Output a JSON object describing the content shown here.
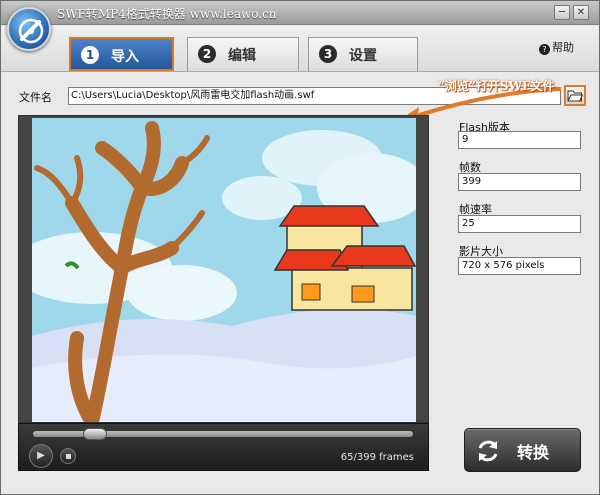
{
  "window": {
    "title": "SWF转MP4格式转换器 www.leawo.cn",
    "minimize_glyph": "─",
    "close_glyph": "✕"
  },
  "tabs": [
    {
      "number": "1",
      "label": "导入",
      "active": true
    },
    {
      "number": "2",
      "label": "编辑",
      "active": false
    },
    {
      "number": "3",
      "label": "设置",
      "active": false
    }
  ],
  "help": {
    "icon_glyph": "?",
    "label": "帮助"
  },
  "file": {
    "label": "文件名",
    "path": "C:\\Users\\Lucia\\Desktop\\风雨雷电交加flash动画.swf",
    "browse_icon": "folder-open-icon"
  },
  "annotation": {
    "text": "“浏览”打开SWF文件"
  },
  "properties": [
    {
      "label": "Flash版本",
      "value": "9"
    },
    {
      "label": "帧数",
      "value": "399"
    },
    {
      "label": "帧速率",
      "value": "25"
    },
    {
      "label": "影片大小",
      "value": "720 x 576 pixels"
    }
  ],
  "player": {
    "frames_text": "65/399 frames",
    "progress": 0.163,
    "play_icon": "play-icon",
    "stop_icon": "stop-icon"
  },
  "convert": {
    "label": "转换",
    "icon": "refresh-icon"
  },
  "colors": {
    "tab_active": "#2f66ad",
    "tab_active_border": "#d67a2a",
    "callout": "#e07b29",
    "sky": "#9fd8ea",
    "ground": "#d8e0f6",
    "roof": "#e8391c",
    "trunk": "#b36a2e"
  }
}
